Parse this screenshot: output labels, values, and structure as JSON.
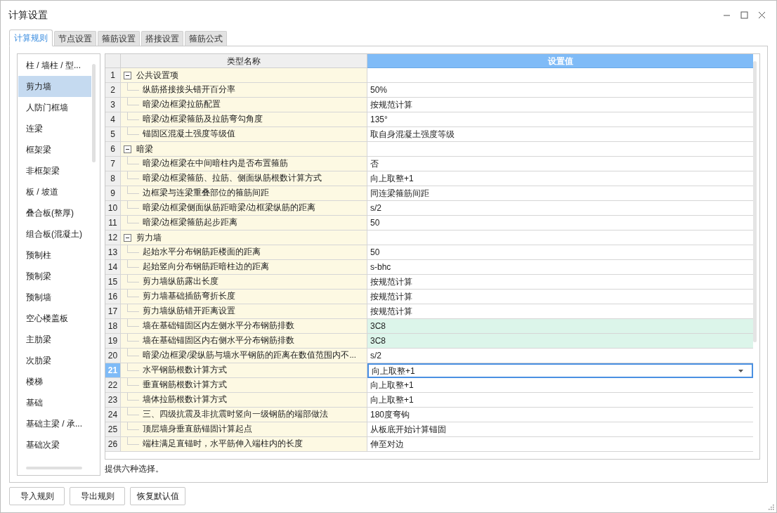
{
  "window": {
    "title": "计算设置"
  },
  "tabs": [
    {
      "label": "计算规则",
      "selected": true
    },
    {
      "label": "节点设置",
      "selected": false
    },
    {
      "label": "箍筋设置",
      "selected": false
    },
    {
      "label": "搭接设置",
      "selected": false
    },
    {
      "label": "箍筋公式",
      "selected": false
    }
  ],
  "sidebar": {
    "items": [
      {
        "label": "柱 / 墙柱 / 型...",
        "selected": false
      },
      {
        "label": "剪力墙",
        "selected": true
      },
      {
        "label": "人防门框墙",
        "selected": false
      },
      {
        "label": "连梁",
        "selected": false
      },
      {
        "label": "框架梁",
        "selected": false
      },
      {
        "label": "非框架梁",
        "selected": false
      },
      {
        "label": "板 / 坡道",
        "selected": false
      },
      {
        "label": "叠合板(整厚)",
        "selected": false
      },
      {
        "label": "组合板(混凝土)",
        "selected": false
      },
      {
        "label": "预制柱",
        "selected": false
      },
      {
        "label": "预制梁",
        "selected": false
      },
      {
        "label": "预制墙",
        "selected": false
      },
      {
        "label": "空心楼盖板",
        "selected": false
      },
      {
        "label": "主肋梁",
        "selected": false
      },
      {
        "label": "次肋梁",
        "selected": false
      },
      {
        "label": "楼梯",
        "selected": false
      },
      {
        "label": "基础",
        "selected": false
      },
      {
        "label": "基础主梁 / 承...",
        "selected": false
      },
      {
        "label": "基础次梁",
        "selected": false
      }
    ]
  },
  "table": {
    "columns": [
      "类型名称",
      "设置值"
    ],
    "rows": [
      {
        "number": "1",
        "name": "公共设置项",
        "kind": "group",
        "expanded": true,
        "selected": false,
        "highlighted": false
      },
      {
        "number": "2",
        "name": "纵筋搭接接头错开百分率",
        "value": "50%",
        "kind": "item",
        "selected": false,
        "highlighted": false
      },
      {
        "number": "3",
        "name": "暗梁/边框梁拉筋配置",
        "value": "按规范计算",
        "kind": "item",
        "selected": false,
        "highlighted": false
      },
      {
        "number": "4",
        "name": "暗梁/边框梁箍筋及拉筋弯勾角度",
        "value": "135°",
        "kind": "item",
        "selected": false,
        "highlighted": false
      },
      {
        "number": "5",
        "name": "锚固区混凝土强度等级值",
        "value": "取自身混凝土强度等级",
        "kind": "item",
        "selected": false,
        "highlighted": false
      },
      {
        "number": "6",
        "name": "暗梁",
        "kind": "group",
        "expanded": true,
        "selected": false,
        "highlighted": false
      },
      {
        "number": "7",
        "name": "暗梁/边框梁在中间暗柱内是否布置箍筋",
        "value": "否",
        "kind": "item",
        "selected": false,
        "highlighted": false
      },
      {
        "number": "8",
        "name": "暗梁/边框梁箍筋、拉筋、侧面纵筋根数计算方式",
        "value": "向上取整+1",
        "kind": "item",
        "selected": false,
        "highlighted": false
      },
      {
        "number": "9",
        "name": "边框梁与连梁重叠部位的箍筋间距",
        "value": "同连梁箍筋间距",
        "kind": "item",
        "selected": false,
        "highlighted": false
      },
      {
        "number": "10",
        "name": "暗梁/边框梁侧面纵筋距暗梁/边框梁纵筋的距离",
        "value": "s/2",
        "kind": "item",
        "selected": false,
        "highlighted": false
      },
      {
        "number": "11",
        "name": "暗梁/边框梁箍筋起步距离",
        "value": "50",
        "kind": "item",
        "selected": false,
        "highlighted": false
      },
      {
        "number": "12",
        "name": "剪力墙",
        "kind": "group",
        "expanded": true,
        "selected": false,
        "highlighted": false
      },
      {
        "number": "13",
        "name": "起始水平分布钢筋距楼面的距离",
        "value": "50",
        "kind": "item",
        "selected": false,
        "highlighted": false
      },
      {
        "number": "14",
        "name": "起始竖向分布钢筋距暗柱边的距离",
        "value": "s-bhc",
        "kind": "item",
        "selected": false,
        "highlighted": false
      },
      {
        "number": "15",
        "name": "剪力墙纵筋露出长度",
        "value": "按规范计算",
        "kind": "item",
        "selected": false,
        "highlighted": false
      },
      {
        "number": "16",
        "name": "剪力墙基础插筋弯折长度",
        "value": "按规范计算",
        "kind": "item",
        "selected": false,
        "highlighted": false
      },
      {
        "number": "17",
        "name": "剪力墙纵筋错开距离设置",
        "value": "按规范计算",
        "kind": "item",
        "selected": false,
        "highlighted": false
      },
      {
        "number": "18",
        "name": "墙在基础锚固区内左侧水平分布钢筋排数",
        "value": "3C8",
        "kind": "item",
        "selected": false,
        "highlighted": true
      },
      {
        "number": "19",
        "name": "墙在基础锚固区内右侧水平分布钢筋排数",
        "value": "3C8",
        "kind": "item",
        "selected": false,
        "highlighted": true
      },
      {
        "number": "20",
        "name": "暗梁/边框梁/梁纵筋与墙水平钢筋的距离在数值范围内不...",
        "value": "s/2",
        "kind": "item",
        "selected": false,
        "highlighted": false
      },
      {
        "number": "21",
        "name": "水平钢筋根数计算方式",
        "value": "向上取整+1",
        "kind": "item",
        "selected": true,
        "highlighted": false
      },
      {
        "number": "22",
        "name": "垂直钢筋根数计算方式",
        "value": "向上取整+1",
        "kind": "item",
        "selected": false,
        "highlighted": false
      },
      {
        "number": "23",
        "name": "墙体拉筋根数计算方式",
        "value": "向上取整+1",
        "kind": "item",
        "selected": false,
        "highlighted": false
      },
      {
        "number": "24",
        "name": "三、四级抗震及非抗震时竖向一级钢筋的端部做法",
        "value": "180度弯钩",
        "kind": "item",
        "selected": false,
        "highlighted": false
      },
      {
        "number": "25",
        "name": "顶层墙身垂直筋锚固计算起点",
        "value": "从板底开始计算锚固",
        "kind": "item",
        "selected": false,
        "highlighted": false
      },
      {
        "number": "26",
        "name": "端柱满足直锚时，水平筋伸入端柱内的长度",
        "value": "伸至对边",
        "kind": "item",
        "selected": false,
        "highlighted": false
      }
    ]
  },
  "hint": "提供六种选择。",
  "buttons": [
    "导入规则",
    "导出规则",
    "恢复默认值"
  ]
}
